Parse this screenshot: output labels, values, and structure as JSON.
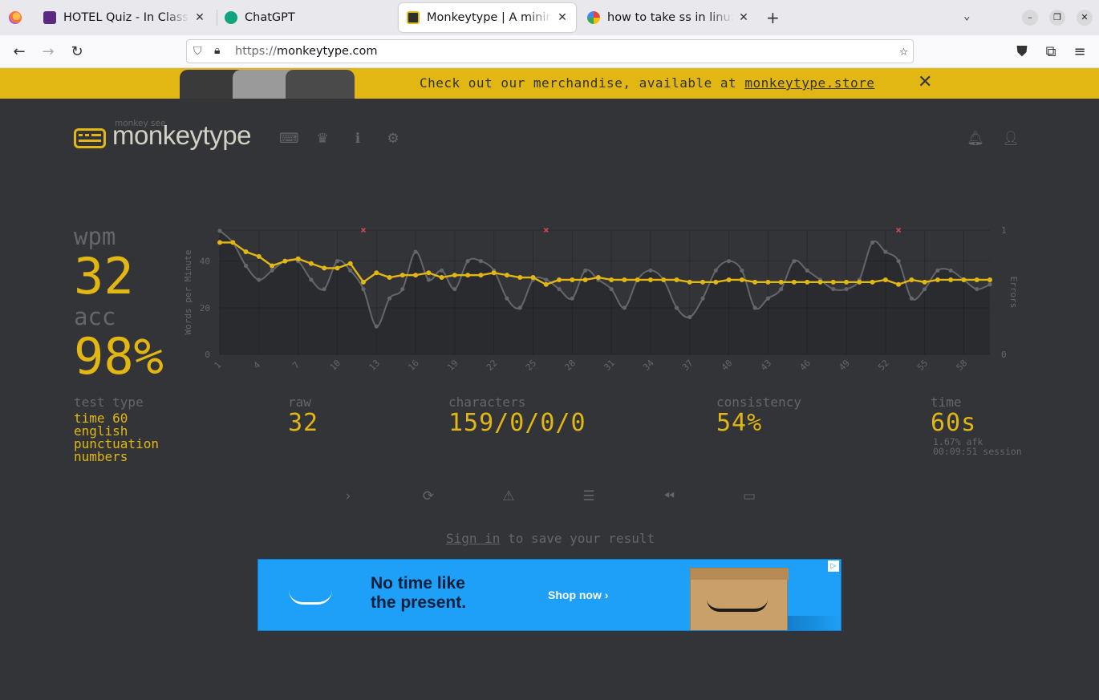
{
  "browser": {
    "tabs": [
      {
        "title": "HOTEL Quiz - In Class Con",
        "fav_color": "#5a2a82"
      },
      {
        "title": "ChatGPT",
        "fav_color": "#10a37f"
      },
      {
        "title": "Monkeytype | A minimalis",
        "fav_color": "#e2b714",
        "active": true
      },
      {
        "title": "how to take ss in linux - G",
        "fav_color": "#4285f4"
      }
    ],
    "url_scheme": "https://",
    "url_host": "monkeytype.com"
  },
  "banner": {
    "text": "Check out our merchandise, available at ",
    "link": "monkeytype.store",
    "close": "✕"
  },
  "header": {
    "logo_top": "monkey see",
    "logo_text": "monkeytype"
  },
  "result": {
    "wpm_label": "wpm",
    "wpm": "32",
    "acc_label": "acc",
    "acc": "98%",
    "test_type_label": "test type",
    "test_type": [
      "time 60",
      "english",
      "punctuation",
      "numbers"
    ],
    "raw_label": "raw",
    "raw": "32",
    "characters_label": "characters",
    "characters": "159/0/0/0",
    "consistency_label": "consistency",
    "consistency": "54%",
    "time_label": "time",
    "time": "60s",
    "afk": "1.67% afk",
    "session": "00:09:51 session"
  },
  "footer": {
    "signin_link": "Sign in",
    "signin_rest": " to save your result"
  },
  "ad": {
    "headline_1": "No time like",
    "headline_2": "the present.",
    "cta": "Shop now ›"
  },
  "colors": {
    "bg": "#323437",
    "main": "#e2b714",
    "sub": "#646669",
    "text": "#d1d0c5",
    "error": "#ca4754"
  },
  "chart_data": {
    "type": "line",
    "ylabel": "Words per Minute",
    "y2label": "Errors",
    "ylim": [
      0,
      53.3
    ],
    "y2lim": [
      0,
      1
    ],
    "yticks": [
      0,
      20,
      40
    ],
    "y2ticks": [
      0,
      1
    ],
    "xticks": [
      1,
      4,
      7,
      10,
      13,
      16,
      19,
      22,
      25,
      28,
      31,
      34,
      37,
      40,
      43,
      46,
      49,
      52,
      55,
      58
    ],
    "x": [
      1,
      2,
      3,
      4,
      5,
      6,
      7,
      8,
      9,
      10,
      11,
      12,
      13,
      14,
      15,
      16,
      17,
      18,
      19,
      20,
      21,
      22,
      23,
      24,
      25,
      26,
      27,
      28,
      29,
      30,
      31,
      32,
      33,
      34,
      35,
      36,
      37,
      38,
      39,
      40,
      41,
      42,
      43,
      44,
      45,
      46,
      47,
      48,
      49,
      50,
      51,
      52,
      53,
      54,
      55,
      56,
      57,
      58,
      59,
      60
    ],
    "series": [
      {
        "name": "wpm",
        "color": "#e2b714",
        "values": [
          48,
          48,
          44,
          42,
          38,
          40,
          41,
          39,
          37,
          37,
          39,
          31,
          35,
          33,
          34,
          34,
          35,
          33,
          34,
          34,
          34,
          35,
          34,
          33,
          33,
          30,
          32,
          32,
          32,
          33,
          32,
          32,
          32,
          32,
          32,
          32,
          31,
          31,
          31,
          32,
          32,
          31,
          31,
          31,
          31,
          31,
          31,
          31,
          31,
          31,
          31,
          32,
          30,
          32,
          31,
          32,
          32,
          32,
          32,
          32
        ]
      },
      {
        "name": "raw",
        "color": "#646669",
        "values": [
          53,
          48,
          38,
          32,
          36,
          40,
          40,
          32,
          28,
          40,
          36,
          28,
          12,
          24,
          28,
          44,
          32,
          36,
          28,
          40,
          40,
          36,
          24,
          20,
          32,
          32,
          28,
          24,
          36,
          32,
          28,
          20,
          32,
          36,
          32,
          20,
          16,
          24,
          36,
          40,
          36,
          20,
          24,
          28,
          40,
          36,
          32,
          28,
          28,
          32,
          48,
          44,
          40,
          24,
          28,
          36,
          36,
          32,
          28,
          30
        ]
      }
    ],
    "errors": [
      {
        "x": 12,
        "count": 1
      },
      {
        "x": 26,
        "count": 1
      },
      {
        "x": 53,
        "count": 1
      }
    ]
  }
}
